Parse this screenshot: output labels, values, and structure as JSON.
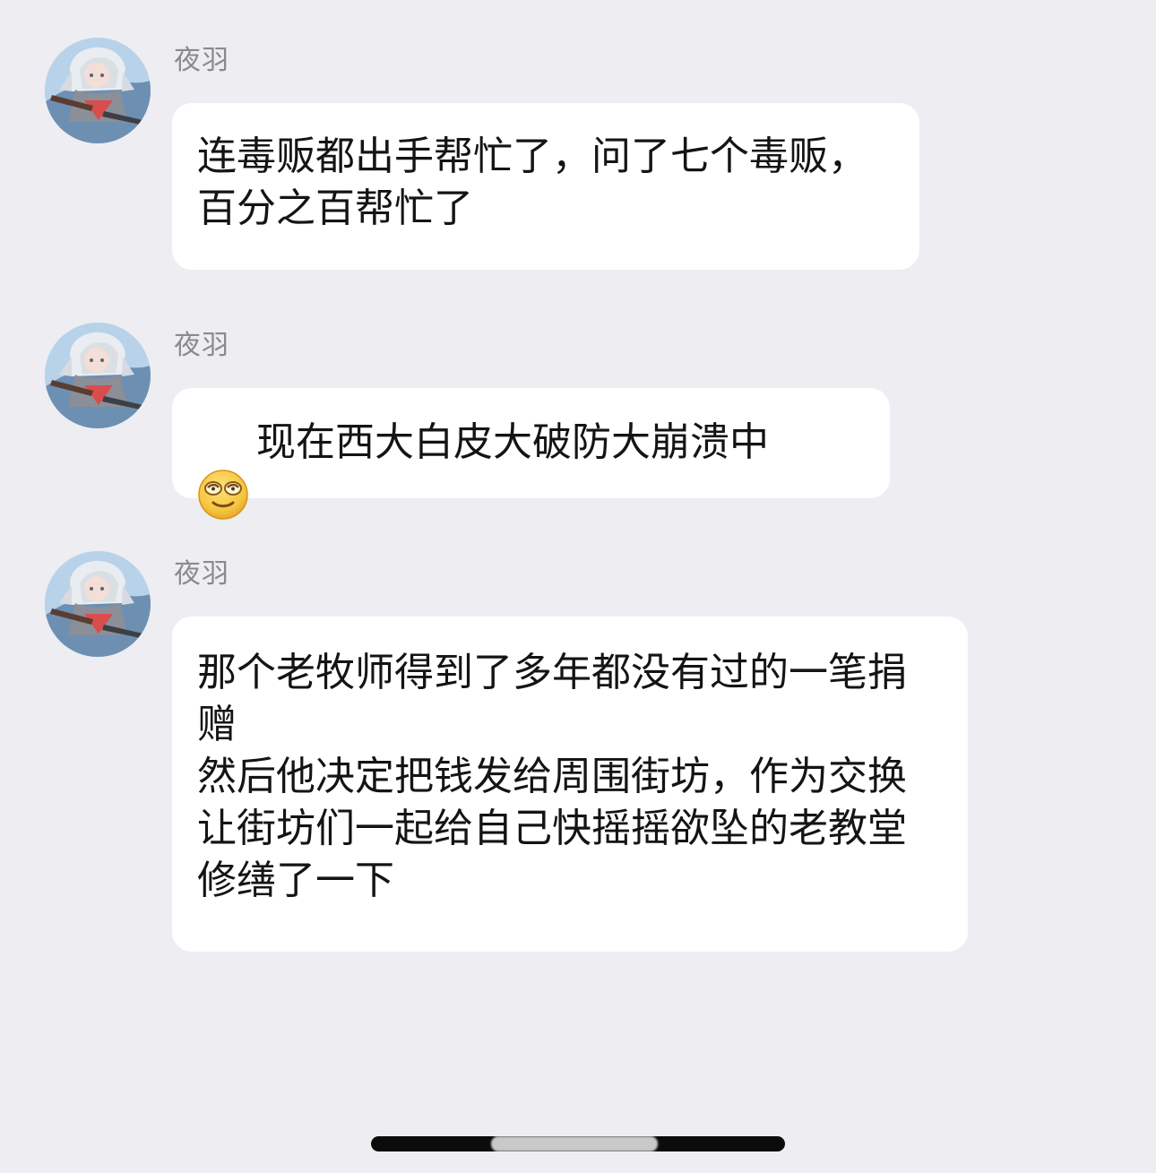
{
  "chat": {
    "messages": [
      {
        "sender": "夜羽",
        "avatar_icon": "anime-character-avatar-icon",
        "text": "连毒贩都出手帮忙了，问了七个毒贩，百分之百帮忙了"
      },
      {
        "sender": "夜羽",
        "avatar_icon": "anime-character-avatar-icon",
        "emoji_icon": "smirk-face-emoji-icon",
        "text": "现在西大白皮大破防大崩溃中"
      },
      {
        "sender": "夜羽",
        "avatar_icon": "anime-character-avatar-icon",
        "text": "那个老牧师得到了多年都没有过的一笔捐赠\n然后他决定把钱发给周围街坊，作为交换让街坊们一起给自己快摇摇欲坠的老教堂修缮了一下"
      }
    ]
  },
  "colors": {
    "background": "#ededf2",
    "bubble": "#ffffff",
    "sender_text": "#8a8a8a",
    "message_text": "#141414",
    "home_indicator": "#0b0b0b"
  }
}
